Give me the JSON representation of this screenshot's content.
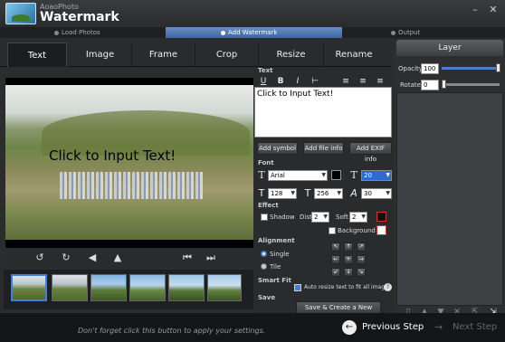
{
  "app": {
    "small_name": "AoaoPhoto",
    "title": "Watermark",
    "accent": "#3d65a3"
  },
  "window_controls": {
    "minimize": "–",
    "close": "✕"
  },
  "steps": [
    {
      "label": "Load Photos",
      "active": false
    },
    {
      "label": "Add Watermark",
      "active": true
    },
    {
      "label": "Output",
      "active": false
    }
  ],
  "tabs": [
    "Text",
    "Image",
    "Frame",
    "Crop",
    "Resize",
    "Rename"
  ],
  "active_tab": "Text",
  "preview": {
    "watermark_text": "Click to Input Text!"
  },
  "controls": {
    "rotate_left": "↺",
    "rotate_right": "↻",
    "flip_h": "◀",
    "flip_v": "▲",
    "prev": "⏮",
    "next": "⏭"
  },
  "thumbnails": [
    "thumb-1",
    "thumb-2",
    "thumb-3",
    "thumb-4",
    "thumb-5",
    "thumb-6"
  ],
  "text_section": {
    "header": "Text",
    "toolbar_icons": {
      "underline": "U",
      "bold": "B",
      "italic": "I",
      "strike": "⊢",
      "align_left": "≡",
      "align_center": "≡",
      "align_right": "≡"
    },
    "content": "Click to Input Text!",
    "buttons": {
      "add_symbol": "Add symbol",
      "add_file_info": "Add file info",
      "add_exif_info": "Add EXIF info"
    }
  },
  "font_section": {
    "header": "Font",
    "font_name": "Arial",
    "font_size": "20",
    "width": "128",
    "height": "256",
    "spacing": "30",
    "color": "#000000"
  },
  "effect_section": {
    "header": "Effect",
    "shadow_label": "Shadow",
    "dist_label": "Dist",
    "dist_value": "2",
    "soft_label": "Soft",
    "soft_value": "2",
    "background_label": "Background"
  },
  "alignment_section": {
    "header": "Alignment",
    "single_label": "Single",
    "tile_label": "Tile",
    "arrows": [
      "↖",
      "↑",
      "↗",
      "←",
      "+",
      "→",
      "↙",
      "↓",
      "↘"
    ]
  },
  "smart_fit": {
    "header": "Smart Fit",
    "checkbox_label": "Auto resize text to fit all images",
    "help": "?"
  },
  "save_section": {
    "header": "Save",
    "button": "Save & Create a New Layer"
  },
  "layer_panel": {
    "title": "Layer",
    "opacity_label": "Opacity",
    "opacity_value": "100",
    "rotate_label": "Rotate",
    "rotate_value": "0"
  },
  "layer_tools": [
    "layer-tool-1",
    "layer-tool-2",
    "layer-tool-3",
    "layer-tool-4",
    "layer-tool-5",
    "layer-tool-6"
  ],
  "bottom": {
    "hint": "Don't forget click this button to apply your settings.",
    "previous_step": "Previous Step",
    "next_step": "Next Step"
  }
}
